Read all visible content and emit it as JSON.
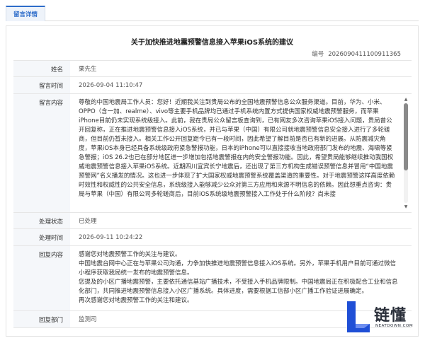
{
  "tab": {
    "label": "留言详情"
  },
  "page": {
    "title": "关于加快推进地震预警信息接入苹果iOS系统的建议",
    "serial_label": "编号",
    "serial_value": "2026090411100911365"
  },
  "fields": {
    "name": {
      "label": "姓名",
      "value": "栗先生"
    },
    "time": {
      "label": "留言时间",
      "value": "2026-09-04 11:10:47"
    },
    "content": {
      "label": "留言内容",
      "value": "尊敬的中国地震局工作人员：您好！近期我关注到贵局公布的全国地震预警信息公众服务渠道。目前，华为、小米、OPPO（含一加、realme）、vivo等主要手机品牌均已通过手机系统内置方式提供国家权威地震预警服务，而苹果iPhone目前仍未实现系统级接入。此前，我在贵局公众留言板查询到，已有网友多次咨询苹果iOS接入问题，贵局曾公开回复称，正在推进地震预警信息接入iOS系统，并已与苹果（中国）有限公司就地震预警信息安全接入进行了多轮磋商，但目前仍暂未接入。相关工作公开回复距今已有一段时间，因此希望了解目前是否已有新的进展。从防震减灾角度，苹果iOS本身已经具备系统级政府紧急警报功能，日本的iPhone可以直接接收当地政府部门发布的地震、海啸等紧急警报；iOS 26.2也已在部分地区进一步增加包括地震警报在内的安全警报功能。因此，希望贵局能够继续推动我国权威地震预警信息接入苹果iOS系统。近期四川宜宾长宁地震后，还出现了第三方机构生成错误预警信息并冒用“中国地震预警网”名义播发的情况。这也进一步体现了扩大国家权威地震预警系统覆盖渠道的重要性。对于地震预警这样高度依赖时效性和权威性的公共安全信息，系统级接入能够减少公众对第三方应用和来源不明信息的依赖。因此想重点咨询：贵局与苹果（中国）有限公司多轮磋商后，目前iOS系统级地震预警接入工作处于什么阶段？尚未接"
    },
    "status": {
      "label": "处理状态",
      "value": "已处理"
    },
    "handle_time": {
      "label": "处理时间",
      "value": "2026-09-11 10:24:22"
    },
    "reply": {
      "label": "回复内容",
      "lines": [
        "感谢您对地震预警工作的关注与建议。",
        "中国地震台网中心正在与苹果公司沟通，力争加快推进地震预警信息接入iOS系统。另外，苹果手机用户目前可通过微信小程序获取我局统一发布的地震预警信息。",
        "您提及的小区广播地震预警，主要依托通信基站广播技术，不受接入手机品牌限制。中国地震局正在积极配合工业和信息化部门，共同推进地震预警信息接入小区广播系统。具体进度，需要根据工信部小区广播工作验证进展确定。",
        "再次感谢您对地震预警工作的关注和建议。"
      ]
    },
    "dept": {
      "label": "回复部门",
      "value": "监测司"
    }
  },
  "watermark": {
    "brand": "链懂",
    "site": "NEATDOWN.COM"
  },
  "colors": {
    "accent": "#2d6cc9",
    "logo_blue": "#1f4fd6",
    "label_bg": "#f5f7fa"
  }
}
